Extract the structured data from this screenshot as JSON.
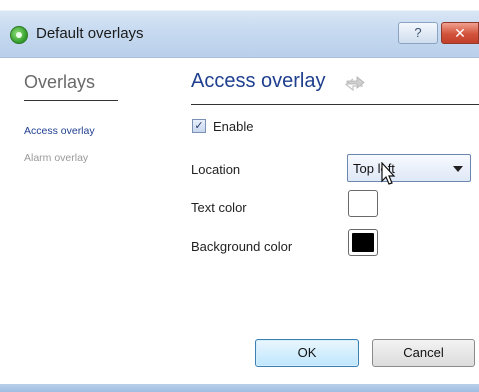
{
  "window": {
    "title": "Default overlays",
    "help_label": "?",
    "close_label": "✕"
  },
  "nav": {
    "heading": "Overlays",
    "items": [
      {
        "label": "Access overlay",
        "active": true
      },
      {
        "label": "Alarm overlay",
        "active": false
      }
    ]
  },
  "panel": {
    "title": "Access overlay",
    "enable": {
      "label": "Enable",
      "checked": true,
      "check_glyph": "✓"
    },
    "location": {
      "label": "Location",
      "value": "Top left"
    },
    "text_color": {
      "label": "Text color",
      "value": "#ffffff"
    },
    "background_color": {
      "label": "Background color",
      "value": "#000000"
    }
  },
  "buttons": {
    "ok": "OK",
    "cancel": "Cancel"
  },
  "colors": {
    "accent": "#1f3f8f",
    "titlebar": "#c7daf0",
    "close": "#d2533b"
  },
  "icons": [
    "app-eye-icon",
    "refresh-arrows-icon",
    "chevron-down-icon",
    "mouse-cursor-icon",
    "help-icon",
    "close-icon",
    "check-icon"
  ]
}
